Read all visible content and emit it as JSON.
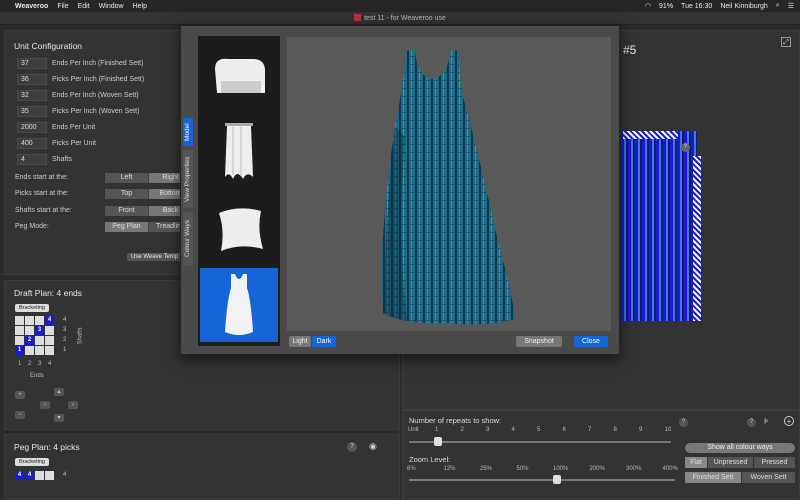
{
  "menubar": {
    "app_name": "Weaveroo",
    "items": [
      "File",
      "Edit",
      "Window",
      "Help"
    ],
    "battery": "91%",
    "clock": "Tue 16:30",
    "user": "Neil Kinniburgh"
  },
  "window": {
    "title": "test 11 - for Weaveroo use"
  },
  "unit_config": {
    "title": "Unit Configuration",
    "fields": [
      {
        "value": "37",
        "label": "Ends Per Inch (Finished Sett)"
      },
      {
        "value": "36",
        "label": "Picks Per Inch (Finished Sett)"
      },
      {
        "value": "32",
        "label": "Ends Per Inch (Woven Sett)"
      },
      {
        "value": "35",
        "label": "Picks Per Inch (Woven Sett)"
      },
      {
        "value": "2000",
        "label": "Ends Per Unit"
      },
      {
        "value": "400",
        "label": "Picks Per Unit"
      },
      {
        "value": "4",
        "label": "Shafts"
      }
    ],
    "ends_start": {
      "label": "Ends start at the:",
      "options": [
        "Left",
        "Right"
      ]
    },
    "picks_start": {
      "label": "Picks start at the:",
      "options": [
        "Top",
        "Bottom"
      ]
    },
    "shafts_start": {
      "label": "Shafts start at the:",
      "options": [
        "Front",
        "Back"
      ]
    },
    "peg_mode": {
      "label": "Peg Mode:",
      "options": [
        "Peg Plan",
        "Treadling"
      ]
    },
    "use_template": "Use Weave Temp"
  },
  "draft_plan": {
    "title": "Draft Plan:  4 ends",
    "bracketing": "Bracketing",
    "shafts_label": "Shafts",
    "ends_label": "Ends",
    "row_nums": [
      "4",
      "3",
      "2",
      "1"
    ],
    "col_nums": [
      "1",
      "2",
      "3",
      "4"
    ],
    "cells": [
      "4",
      "3",
      "2",
      "1"
    ]
  },
  "peg_plan": {
    "title": "Peg Plan:  4 picks",
    "bracketing": "Bracketing",
    "cells": [
      "4",
      "4"
    ],
    "row_num": "4"
  },
  "modal": {
    "tabs": [
      "Model",
      "View Properties",
      "Colour Ways"
    ],
    "light_dark": [
      "Light",
      "Dark"
    ],
    "snapshot": "Snapshot",
    "close": "Close"
  },
  "right_panel": {
    "title_suffix": "#5",
    "repeats_label": "Number of repeats to show:",
    "unit_label": "Unit",
    "repeat_ticks": [
      "1",
      "2",
      "3",
      "4",
      "5",
      "6",
      "7",
      "8",
      "9",
      "10"
    ],
    "repeats_value": 1,
    "zoom_label": "Zoom Level:",
    "zoom_ticks": [
      "6%",
      "12%",
      "25%",
      "50%",
      "100%",
      "200%",
      "300%",
      "400%"
    ],
    "zoom_value": "100%",
    "show_all_colour_ways": "Show all colour ways",
    "render_modes": [
      "Flat",
      "Unpressed",
      "Pressed"
    ],
    "sett_modes": [
      "Finished Sett",
      "Woven Sett"
    ]
  },
  "colors": {
    "accent": "#1565d8",
    "fabric_blue": "#1a1ad6"
  }
}
